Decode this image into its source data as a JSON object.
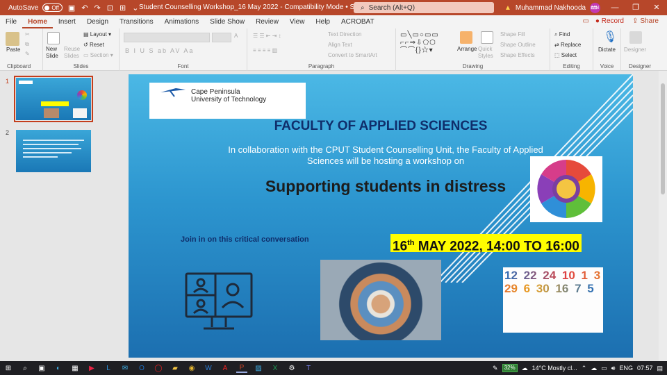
{
  "titlebar": {
    "autosave_label": "AutoSave",
    "autosave_state": "Off",
    "doc_title": "Student Counselling Workshop_16 May 2022  -  Compatibility Mode • Saved to this PC ∨",
    "search_placeholder": "Search (Alt+Q)",
    "user_name": "Muhammad Nakhooda",
    "user_initials": "MN"
  },
  "menu": {
    "tabs": [
      "File",
      "Home",
      "Insert",
      "Design",
      "Transitions",
      "Animations",
      "Slide Show",
      "Review",
      "View",
      "Help",
      "ACROBAT"
    ],
    "active": "Home",
    "record": "Record",
    "share": "Share"
  },
  "ribbon": {
    "clipboard": {
      "paste": "Paste",
      "label": "Clipboard"
    },
    "slides": {
      "new_slide": "New Slide",
      "reuse": "Reuse Slides",
      "layout": "Layout",
      "reset": "Reset",
      "section": "Section",
      "label": "Slides"
    },
    "font": {
      "label": "Font",
      "styles": "B  I  U  S  ab  AV  Aa"
    },
    "paragraph": {
      "text_direction": "Text Direction",
      "align_text": "Align Text",
      "convert_smartart": "Convert to SmartArt",
      "label": "Paragraph"
    },
    "drawing": {
      "arrange": "Arrange",
      "quick_styles": "Quick Styles",
      "shape_fill": "Shape Fill",
      "shape_outline": "Shape Outline",
      "shape_effects": "Shape Effects",
      "label": "Drawing"
    },
    "editing": {
      "find": "Find",
      "replace": "Replace",
      "select": "Select",
      "label": "Editing"
    },
    "voice": {
      "dictate": "Dictate",
      "label": "Voice"
    },
    "designer": {
      "designer": "Designer",
      "label": "Designer"
    }
  },
  "thumbnails": [
    {
      "num": "1",
      "selected": true
    },
    {
      "num": "2",
      "selected": false
    }
  ],
  "slide": {
    "logo_line1": "Cape Peninsula",
    "logo_line2": "University of Technology",
    "faculty": "FACULTY OF APPLIED SCIENCES",
    "collab": "In collaboration with the CPUT Student Counselling Unit, the Faculty of Applied Sciences will be hosting a workshop on",
    "headline": "Supporting students in distress",
    "join": "Join in on this critical conversation",
    "date_day": "16",
    "date_suffix": "th",
    "date_rest": " MAY 2022, 14:00 TO 16:00",
    "calendar_numbers": "12 22 24 10 1 3 29 6 30 16 7 5"
  },
  "taskbar": {
    "battery": "32%",
    "weather": "14°C  Mostly cl...",
    "lang": "ENG",
    "time": "07:57"
  },
  "colors": {
    "accent": "#b7472a",
    "slide_top": "#4bb8e5",
    "slide_bottom": "#1c6fb0",
    "highlight": "#fffd00"
  }
}
